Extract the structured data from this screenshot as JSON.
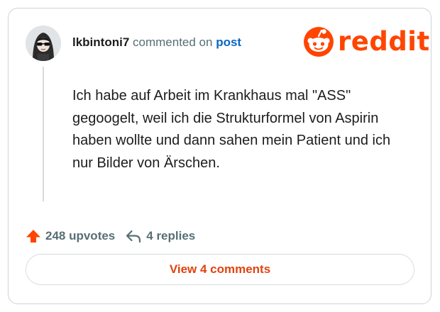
{
  "comment": {
    "username": "lkbintoni7",
    "action_text": " commented on ",
    "post_link": "post",
    "body": "Ich habe auf Arbeit im Krankhaus mal \"ASS\" gegoogelt, weil ich die Strukturformel von Aspirin haben wollte und dann sahen mein Patient und ich nur Bilder von Ärschen."
  },
  "brand": {
    "logo_text": "reddit",
    "logo_icon": "reddit-snoo-icon",
    "color": "#ff4500"
  },
  "actions": {
    "upvotes_label": "248 upvotes",
    "upvote_icon": "upvote-arrow-icon",
    "replies_label": "4 replies",
    "reply_icon": "reply-arrow-icon"
  },
  "footer": {
    "view_comments_label": "View 4 comments"
  },
  "colors": {
    "text": "#1c1c1c",
    "muted": "#576f76",
    "link": "#0a66c2",
    "accent": "#ff4500",
    "border": "#cfd3d6"
  }
}
